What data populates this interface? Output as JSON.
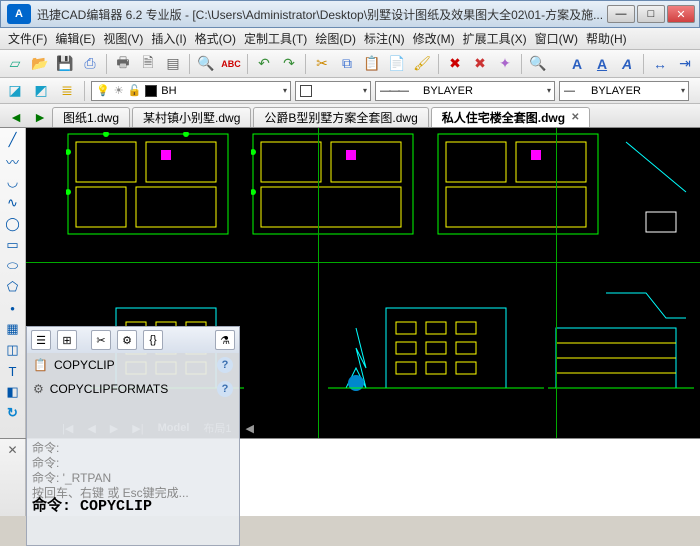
{
  "window": {
    "app_icon_text": "A",
    "title": "迅捷CAD编辑器 6.2 专业版  -  [C:\\Users\\Administrator\\Desktop\\别墅设计图纸及效果图大全02\\01-方案及施..."
  },
  "win_buttons": {
    "min": "—",
    "max": "□",
    "close": "✕"
  },
  "menu": [
    "文件(F)",
    "编辑(E)",
    "视图(V)",
    "插入(I)",
    "格式(O)",
    "定制工具(T)",
    "绘图(D)",
    "标注(N)",
    "修改(M)",
    "扩展工具(X)",
    "窗口(W)",
    "帮助(H)"
  ],
  "props": {
    "layer_icon": "💡",
    "layer_name": "BH",
    "color_label": "",
    "linetype": "BYLAYER",
    "lineweight": "BYLAYER"
  },
  "tabs": [
    {
      "label": "图纸1.dwg",
      "active": false,
      "closable": false
    },
    {
      "label": "某村镇小别墅.dwg",
      "active": false,
      "closable": false
    },
    {
      "label": "公爵B型别墅方案全套图.dwg",
      "active": false,
      "closable": false
    },
    {
      "label": "私人住宅楼全套图.dwg",
      "active": true,
      "closable": true
    }
  ],
  "prompt": {
    "items": [
      {
        "icon": "📋",
        "label": "COPYCLIP"
      },
      {
        "icon": "⚙",
        "label": "COPYCLIPFORMATS"
      }
    ]
  },
  "model_tabs": {
    "nav": [
      "|◀",
      "◀",
      "▶",
      "▶|"
    ],
    "items": [
      "Model",
      "布局1"
    ]
  },
  "cmd": {
    "lines": [
      "命令:",
      "命令:",
      "命令:  '_RTPAN",
      "按回车、右键 或 Esc键完成..."
    ],
    "active": "命令:  COPYCLIP"
  },
  "toolbar_letters": {
    "a1": "A",
    "a2": "A",
    "a3": "A"
  },
  "tool_colors": {
    "new": "#2a8",
    "open": "#e8a030",
    "save": "#3a6fd0",
    "saveall": "#3a6fd0",
    "print": "#888",
    "preview": "#666",
    "find": "#3a6fd0",
    "abc": "#c00",
    "undo": "#3a8f3a",
    "redo": "#3a8f3a",
    "cut": "#cc8800",
    "copy": "#3a6fd0",
    "paste": "#3a6fd0",
    "del": "#c00",
    "x1": "#c00",
    "x2": "#c33",
    "zoom": "#06c",
    "layers": "#d4a000"
  }
}
